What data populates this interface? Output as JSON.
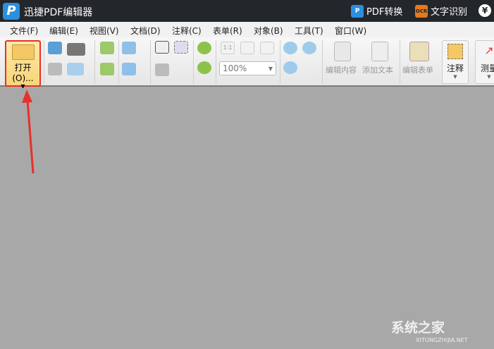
{
  "title": "迅捷PDF编辑器",
  "title_actions": [
    {
      "label": "PDF转换",
      "icon": "pdf-convert-icon"
    },
    {
      "label": "文字识别",
      "icon": "ocr-icon",
      "badge": "OCR"
    },
    {
      "icon": "yen-icon",
      "label": "¥"
    }
  ],
  "menu": [
    "文件(F)",
    "编辑(E)",
    "视图(V)",
    "文档(D)",
    "注释(C)",
    "表单(R)",
    "对象(B)",
    "工具(T)",
    "窗口(W)"
  ],
  "toolbar": {
    "open": "打开(O)...",
    "zoom": "100%",
    "edit_content": "编辑内容",
    "add_text": "添加文本",
    "edit_form": "编辑表单",
    "annotate": "注释",
    "measure": "测量",
    "fit": "1:1"
  },
  "watermark": {
    "text": "系统之家",
    "sub": "XITONGZHIJIA.NET"
  },
  "colors": {
    "highlight": "#e8302a",
    "titlebar": "#23272b"
  }
}
